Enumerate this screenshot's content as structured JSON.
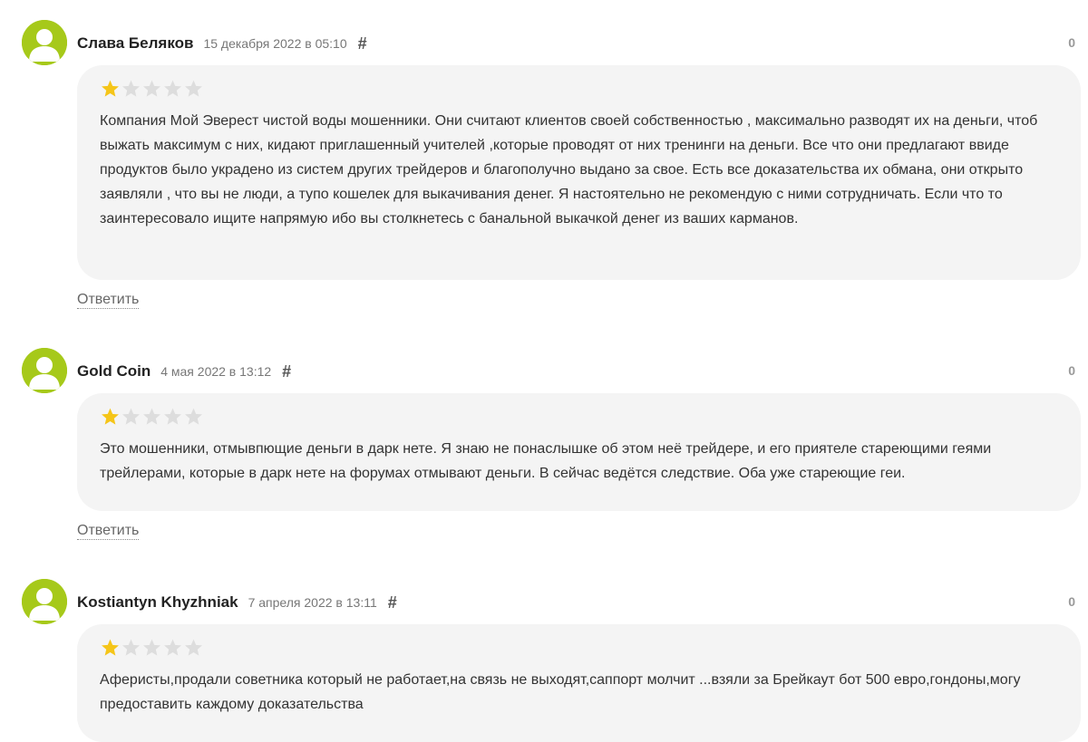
{
  "comments": [
    {
      "author": "Слава Беляков",
      "date": "15 декабря 2022 в 05:10",
      "hash": "#",
      "score": "0",
      "rating": 1,
      "rating_max": 5,
      "text": "Компания Мой Эверест чистой воды мошенники. Они считают клиентов своей собственностью , максимально разводят их на деньги, чтоб выжать максимум с них, кидают приглашенный учителей ,которые проводят от них тренинги на деньги. Все что они предлагают ввиде продуктов было украдено из систем других трейдеров и благополучно выдано за свое. Есть все доказательства их обмана, они открыто заявляли , что вы не люди, а тупо кошелек для выкачивания денег. Я настоятельно не рекомендую с ними сотрудничать. Если что то заинтересовало ищите напрямую ибо вы столкнетесь с банальной выкачкой денег из ваших карманов.",
      "reply_label": "Ответить"
    },
    {
      "author": "Gold Coin",
      "date": "4 мая 2022 в 13:12",
      "hash": "#",
      "score": "0",
      "rating": 1,
      "rating_max": 5,
      "text": "Это мошенники, отмывпющие деньги в дарк нете. Я знаю не понаслышке об этом неё трейдере, и его приятеле стареющими геями трейлерами, которые в дарк нете на форумах отмывают деньги. В сейчас ведётся следствие. Оба уже стареющие геи.",
      "reply_label": "Ответить"
    },
    {
      "author": "Kostiantyn Khyzhniak",
      "date": "7 апреля 2022 в 13:11",
      "hash": "#",
      "score": "0",
      "rating": 1,
      "rating_max": 5,
      "text": "Аферисты,продали советника который не работает,на связь не выходят,саппорт молчит ...взяли за Брейкаут бот 500 евро,гондоны,могу предоставить каждому доказательства",
      "reply_label": ""
    }
  ],
  "colors": {
    "avatar_bg": "#a6c91a",
    "star_filled": "#f5c518",
    "star_empty": "#dddddd",
    "bubble_bg": "#f4f4f4"
  },
  "icons": {
    "avatar": "user-silhouette-icon",
    "star": "star-icon",
    "permalink": "hash-icon"
  }
}
